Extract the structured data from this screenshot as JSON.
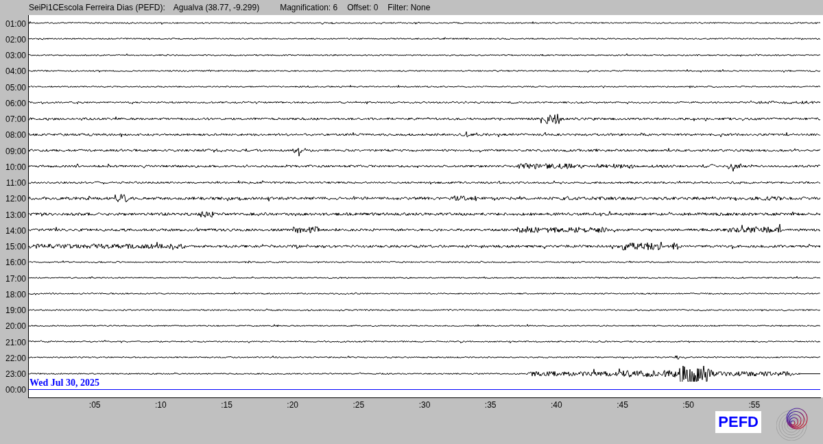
{
  "header": {
    "station": "SeiPi1CEscola Ferreira Dias (PEFD):",
    "location": "Agualva (38.77, -9.299)",
    "magnification": "Magnification: 6",
    "offset": "Offset: 0",
    "filter": "Filter: None"
  },
  "rows": [
    {
      "time": "01:00",
      "kind": "trace"
    },
    {
      "time": "02:00",
      "kind": "trace"
    },
    {
      "time": "03:00",
      "kind": "trace"
    },
    {
      "time": "04:00",
      "kind": "trace"
    },
    {
      "time": "05:00",
      "kind": "trace"
    },
    {
      "time": "06:00",
      "kind": "trace"
    },
    {
      "time": "07:00",
      "kind": "trace"
    },
    {
      "time": "08:00",
      "kind": "trace"
    },
    {
      "time": "09:00",
      "kind": "trace"
    },
    {
      "time": "10:00",
      "kind": "trace"
    },
    {
      "time": "11:00",
      "kind": "trace"
    },
    {
      "time": "12:00",
      "kind": "trace"
    },
    {
      "time": "13:00",
      "kind": "trace"
    },
    {
      "time": "14:00",
      "kind": "trace"
    },
    {
      "time": "15:00",
      "kind": "trace"
    },
    {
      "time": "16:00",
      "kind": "trace"
    },
    {
      "time": "17:00",
      "kind": "trace"
    },
    {
      "time": "18:00",
      "kind": "trace"
    },
    {
      "time": "19:00",
      "kind": "trace"
    },
    {
      "time": "20:00",
      "kind": "trace"
    },
    {
      "time": "21:00",
      "kind": "trace"
    },
    {
      "time": "22:00",
      "kind": "trace"
    },
    {
      "time": "23:00",
      "kind": "trace"
    },
    {
      "time": "00:00",
      "kind": "current"
    }
  ],
  "date": "Wed Jul 30, 2025",
  "x_ticks": [
    ":05",
    ":10",
    ":15",
    ":20",
    ":25",
    ":30",
    ":35",
    ":40",
    ":45",
    ":50",
    ":55"
  ],
  "station_badge": "PEFD"
}
